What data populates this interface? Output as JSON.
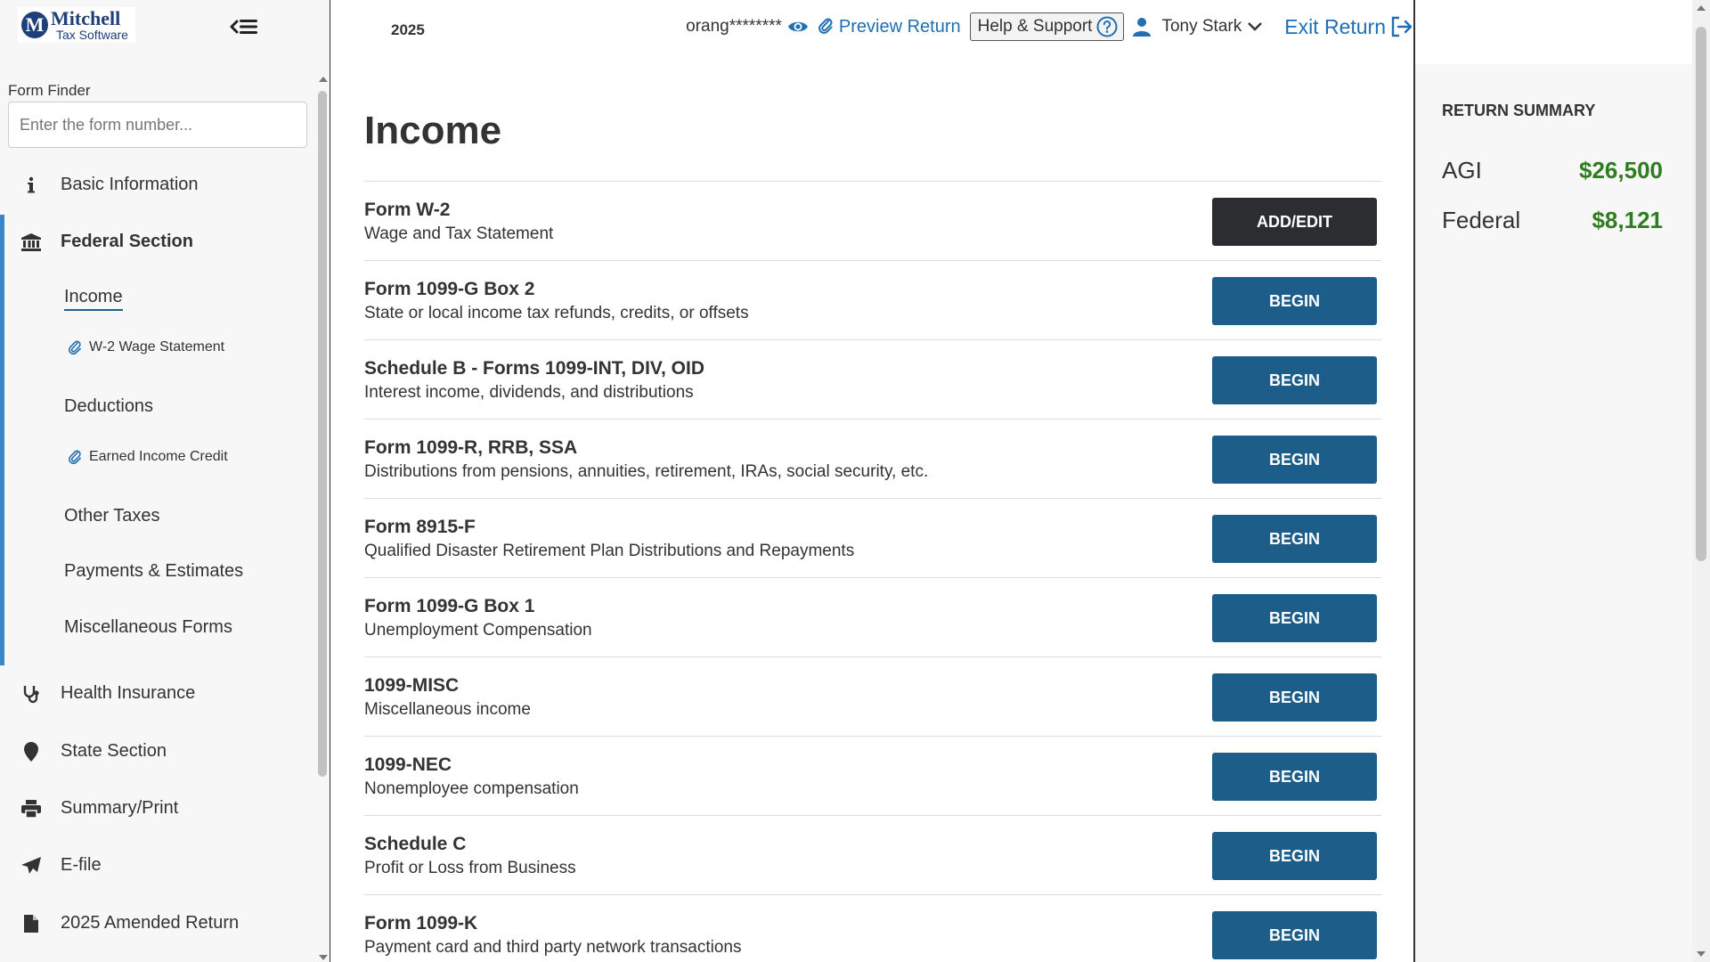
{
  "logo": {
    "name": "Mitchell",
    "sub": "Tax Software",
    "mark": "M"
  },
  "sidebar": {
    "finder_label": "Form Finder",
    "finder_placeholder": "Enter the form number...",
    "items": {
      "basic": "Basic Information",
      "federal": "Federal Section",
      "health": "Health Insurance",
      "state": "State Section",
      "summary": "Summary/Print",
      "efile": "E-file",
      "amended": "2025 Amended Return"
    },
    "federal_sub": {
      "income": "Income",
      "w2": "W-2 Wage Statement",
      "deductions": "Deductions",
      "eic": "Earned Income Credit",
      "other_taxes": "Other Taxes",
      "payments": "Payments & Estimates",
      "misc": "Miscellaneous Forms"
    }
  },
  "topbar": {
    "year": "2025",
    "account": "orang********",
    "preview": "Preview Return",
    "help": "Help & Support",
    "user": "Tony Stark",
    "exit": "Exit Return"
  },
  "main": {
    "title": "Income",
    "forms": [
      {
        "title": "Form W-2",
        "desc": "Wage and Tax Statement",
        "button": "ADD/EDIT"
      },
      {
        "title": "Form 1099-G Box 2",
        "desc": "State or local income tax refunds, credits, or offsets",
        "button": "BEGIN"
      },
      {
        "title": "Schedule B - Forms 1099-INT, DIV, OID",
        "desc": "Interest income, dividends, and distributions",
        "button": "BEGIN"
      },
      {
        "title": "Form 1099-R, RRB, SSA",
        "desc": "Distributions from pensions, annuities, retirement, IRAs, social security, etc.",
        "button": "BEGIN"
      },
      {
        "title": "Form 8915-F",
        "desc": "Qualified Disaster Retirement Plan Distributions and Repayments",
        "button": "BEGIN"
      },
      {
        "title": "Form 1099-G Box 1",
        "desc": "Unemployment Compensation",
        "button": "BEGIN"
      },
      {
        "title": "1099-MISC",
        "desc": "Miscellaneous income",
        "button": "BEGIN"
      },
      {
        "title": "1099-NEC",
        "desc": "Nonemployee compensation",
        "button": "BEGIN"
      },
      {
        "title": "Schedule C",
        "desc": "Profit or Loss from Business",
        "button": "BEGIN"
      },
      {
        "title": "Form 1099-K",
        "desc": "Payment card and third party network transactions",
        "button": "BEGIN"
      }
    ]
  },
  "summary": {
    "title": "RETURN SUMMARY",
    "agi_label": "AGI",
    "agi_value": "$26,500",
    "federal_label": "Federal",
    "federal_value": "$8,121"
  },
  "colors": {
    "begin_button": "#1d5d89",
    "addedit_button": "#2c2d31",
    "link": "#1f6fb2",
    "summary_value": "#2e7d1e",
    "active_bar": "#3a87c8"
  }
}
